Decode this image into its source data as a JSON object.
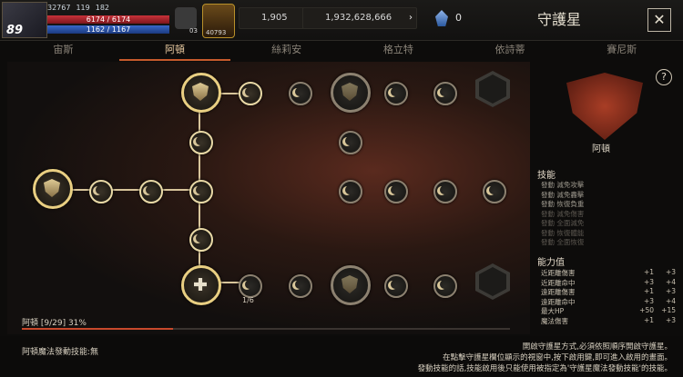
{
  "player": {
    "level": "89",
    "power": "32767",
    "stat_a": "119",
    "stat_b": "182",
    "hp": "6174 / 6174",
    "mp": "1162 / 1167"
  },
  "toolbar": {
    "item_count_a": "03",
    "item_count_b": "40793"
  },
  "currencies": {
    "gems": "1,905",
    "gold": "1,932,628,666",
    "crystal": "0"
  },
  "window": {
    "title": "守護星",
    "close": "✕"
  },
  "tabs": [
    "宙斯",
    "阿頓",
    "絲莉安",
    "格立特",
    "依詩蒂",
    "賽尼斯"
  ],
  "active_tab": 1,
  "board": {
    "node_counter": "1/6",
    "progress_label": "阿頓 [9/29] 31%",
    "progress": 0.31
  },
  "side": {
    "emblem_name": "阿頓",
    "skills_title": "技能",
    "skills": [
      {
        "text": "發動 減免攻擊",
        "dim": false
      },
      {
        "text": "發動 減免轟擊",
        "dim": false
      },
      {
        "text": "發動 恢復負重",
        "dim": false
      },
      {
        "text": "發動 減免傷害",
        "dim": true
      },
      {
        "text": "發動 全面減免",
        "dim": true
      },
      {
        "text": "發動 恢復體能",
        "dim": true
      },
      {
        "text": "發動 全面恢復",
        "dim": true
      }
    ],
    "stats_title": "能力值",
    "stats": [
      {
        "name": "近距離傷害",
        "v1": "+1",
        "v2": "+3"
      },
      {
        "name": "近距離命中",
        "v1": "+3",
        "v2": "+4"
      },
      {
        "name": "遠距離傷害",
        "v1": "+1",
        "v2": "+3"
      },
      {
        "name": "遠距離命中",
        "v1": "+3",
        "v2": "+4"
      },
      {
        "name": "最大HP",
        "v1": "+50",
        "v2": "+15"
      },
      {
        "name": "魔法傷害",
        "v1": "+1",
        "v2": "+3"
      }
    ]
  },
  "footer": {
    "magic_skill": "阿頓魔法發動技能:無",
    "help_line1": "開啟守護星方式,必須依照順序開啟守護星。",
    "help_line2": "在點擊守護星欄位顯示的視窗中,按下啟用鍵,即可進入啟用的畫面。",
    "help_line3": "發動技能的話,技能啟用後只能使用被指定為'守護星魔法發動技能'的技能。"
  }
}
